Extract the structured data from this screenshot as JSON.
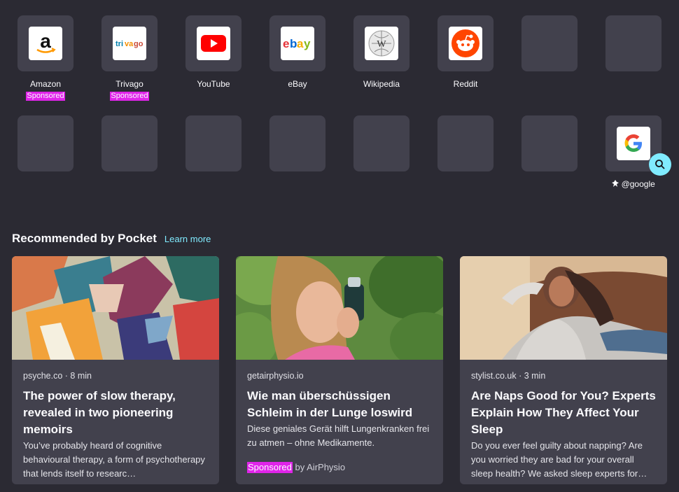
{
  "top_sites": [
    {
      "title": "Amazon",
      "sponsored": "Sponsored",
      "icon": "amazon-icon"
    },
    {
      "title": "Trivago",
      "sponsored": "Sponsored",
      "icon": "trivago-icon"
    },
    {
      "title": "YouTube",
      "icon": "youtube-icon"
    },
    {
      "title": "eBay",
      "icon": "ebay-icon"
    },
    {
      "title": "Wikipedia",
      "icon": "wikipedia-icon"
    },
    {
      "title": "Reddit",
      "icon": "reddit-icon"
    }
  ],
  "search_shortcut": {
    "label": "@google",
    "icon": "google-icon"
  },
  "pocket": {
    "title": "Recommended by Pocket",
    "learn_more": "Learn more",
    "cards": [
      {
        "source": "psyche.co · 8 min",
        "title": "The power of slow therapy, revealed in two pioneering memoirs",
        "excerpt": "You’ve probably heard of cognitive behavioural therapy, a form of psychotherapy that lends itself to researc…"
      },
      {
        "source": "getairphysio.io",
        "title": "Wie man überschüssigen Schleim in der Lunge loswird",
        "excerpt": "Diese geniales Gerät hilft Lungenkranken frei zu atmen – ohne Medikamente.",
        "sponsored": "Sponsored",
        "sponsor_by": "by AirPhysio"
      },
      {
        "source": "stylist.co.uk · 3 min",
        "title": "Are Naps Good for You? Experts Explain How They Affect Your Sleep",
        "excerpt": "Do you ever feel guilty about napping? Are you worried they are bad for your overall sleep health? We asked sleep experts for…"
      }
    ]
  },
  "colors": {
    "background": "#2b2a33",
    "tile": "#42414d",
    "sponsored": "#e024e9",
    "accent": "#80ebff"
  }
}
